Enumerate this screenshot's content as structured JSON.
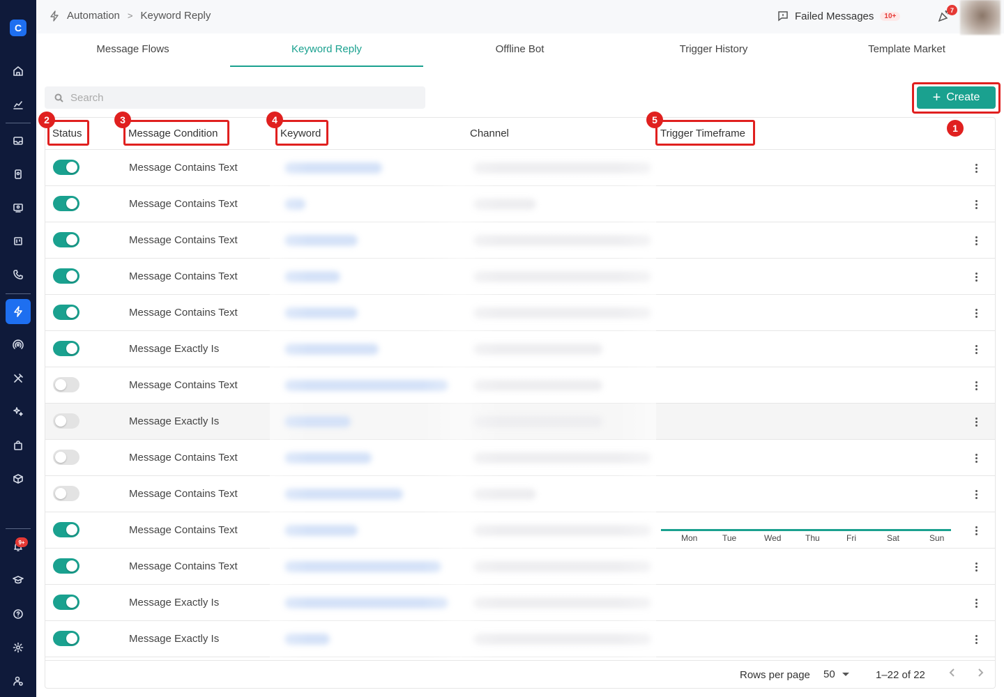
{
  "breadcrumb": {
    "root": "Automation",
    "current": "Keyword Reply"
  },
  "topbar": {
    "failed_label": "Failed Messages",
    "failed_badge": "10+",
    "notif_badge": "7"
  },
  "sidebar": {
    "notif_badge": "9+"
  },
  "tabs": [
    {
      "label": "Message Flows"
    },
    {
      "label": "Keyword Reply"
    },
    {
      "label": "Offline Bot"
    },
    {
      "label": "Trigger History"
    },
    {
      "label": "Template Market"
    }
  ],
  "search": {
    "placeholder": "Search"
  },
  "create": {
    "label": "Create"
  },
  "table": {
    "headers": {
      "status": "Status",
      "condition": "Message Condition",
      "keyword": "Keyword",
      "channel": "Channel",
      "timeframe": "Trigger Timeframe"
    },
    "rows": [
      {
        "on": true,
        "condition": "Message Contains Text"
      },
      {
        "on": true,
        "condition": "Message Contains Text"
      },
      {
        "on": true,
        "condition": "Message Contains Text"
      },
      {
        "on": true,
        "condition": "Message Contains Text"
      },
      {
        "on": true,
        "condition": "Message Contains Text"
      },
      {
        "on": true,
        "condition": "Message Exactly Is"
      },
      {
        "on": false,
        "condition": "Message Contains Text"
      },
      {
        "on": false,
        "condition": "Message Exactly Is"
      },
      {
        "on": false,
        "condition": "Message Contains Text"
      },
      {
        "on": false,
        "condition": "Message Contains Text"
      },
      {
        "on": true,
        "condition": "Message Contains Text"
      },
      {
        "on": true,
        "condition": "Message Contains Text"
      },
      {
        "on": true,
        "condition": "Message Exactly Is"
      },
      {
        "on": true,
        "condition": "Message Exactly Is"
      }
    ],
    "timeframe_days": [
      "Mon",
      "Tue",
      "Wed",
      "Thu",
      "Fri",
      "Sat",
      "Sun"
    ]
  },
  "annotations": {
    "create": "1",
    "status": "2",
    "condition": "3",
    "keyword": "4",
    "timeframe": "5"
  },
  "pagination": {
    "rows_label": "Rows per page",
    "rows_value": "50",
    "range": "1–22 of 22"
  },
  "colors": {
    "accent": "#1aa18f",
    "sidebar": "#0f1a3a",
    "highlight": "#e0201f",
    "active_nav": "#1e6ff0"
  }
}
